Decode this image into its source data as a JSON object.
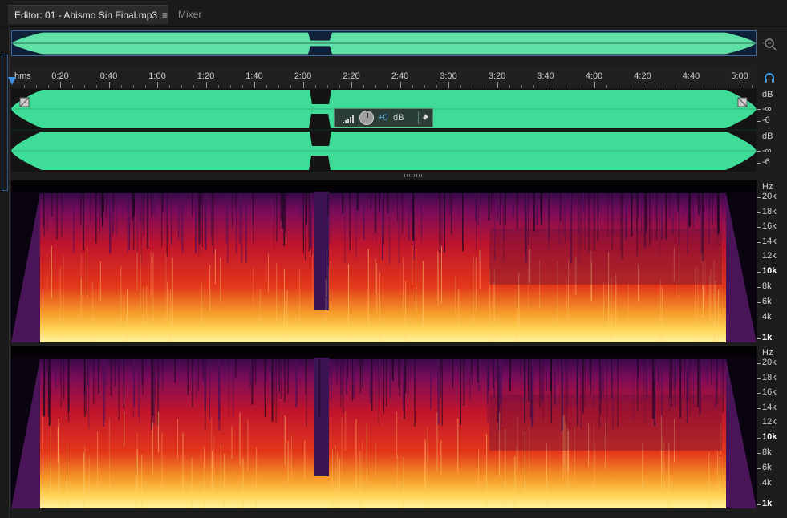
{
  "tabs": {
    "editor_label": "Editor: 01 - Abismo Sin Final.mp3",
    "menu_glyph": "≡",
    "mixer_label": "Mixer"
  },
  "ruler": {
    "unit_label": "hms",
    "ticks": [
      "0:20",
      "0:40",
      "1:00",
      "1:20",
      "1:40",
      "2:00",
      "2:20",
      "2:40",
      "3:00",
      "3:20",
      "3:40",
      "4:00",
      "4:20",
      "4:40",
      "5:00"
    ]
  },
  "waveform": {
    "waveform_color": "#3fdc97",
    "db_scale_ch1": [
      "dB",
      "-∞",
      "-6"
    ],
    "db_scale_ch2": [
      "dB",
      "-∞",
      "-6"
    ]
  },
  "hud": {
    "volume_value": "+0",
    "volume_unit": "dB"
  },
  "spectrogram": {
    "hz_scale": [
      {
        "label": "Hz",
        "bold": false
      },
      {
        "label": "20k",
        "bold": false
      },
      {
        "label": "18k",
        "bold": false
      },
      {
        "label": "16k",
        "bold": false
      },
      {
        "label": "14k",
        "bold": false
      },
      {
        "label": "12k",
        "bold": false
      },
      {
        "label": "10k",
        "bold": true
      },
      {
        "label": "8k",
        "bold": false
      },
      {
        "label": "6k",
        "bold": false
      },
      {
        "label": "4k",
        "bold": false
      },
      {
        "label": "1k",
        "bold": true
      }
    ]
  },
  "icons": {
    "zoom": "zoom-icon",
    "headphones": "headphones-icon",
    "pin": "pin-icon"
  }
}
